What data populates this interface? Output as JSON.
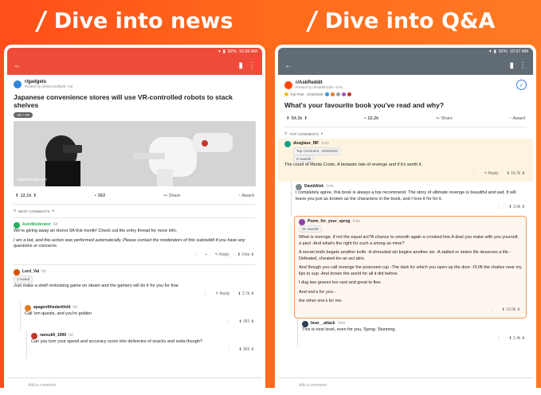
{
  "left_banner": "Dive into news",
  "right_banner": "Dive into Q&A",
  "left": {
    "status": {
      "battery": "92%",
      "time": "10:36 AM"
    },
    "post": {
      "subreddit": "r/gadgets",
      "posted": "Posted by u/MicroSofty88 • 6d",
      "title": "Japanese convenience stores will use VR-controlled robots to stack shelves",
      "flair": "VR / AR",
      "image_caption": "digitaltrends.com",
      "votes": "12.1k",
      "comments": "562",
      "share": "Share",
      "award": "Award"
    },
    "sort_label": "BEST COMMENTS",
    "comments": [
      {
        "author": "AutoModerator",
        "time": "6d",
        "text": "We're giving away an Honor 9A this month! Check out the entry thread for more info.",
        "text2": "I am a bot, and this action was performed automatically. Please contact the moderators of this subreddit if you have any questions or concerns.",
        "reply": "Reply",
        "vote": "Vote"
      },
      {
        "author": "Lord_Val",
        "time": "6d",
        "award": "1 Award",
        "text": "Just make a shelf restocking game on steam and the gamers will do it for you for free",
        "reply": "Reply",
        "votes": "2.7k"
      },
      {
        "author": "apageofthedarkfold",
        "time": "6d",
        "text": "Call 'em quests, and you're golden",
        "votes": "951"
      },
      {
        "author": "nareuk9_1999",
        "time": "6d",
        "text": "Can you turn your speed and accuracy score into deliveries of snacks and soda though?",
        "votes": "362"
      }
    ],
    "add_comment": "Add a comment"
  },
  "right": {
    "status": {
      "battery": "92%",
      "time": "10:37 AM"
    },
    "post": {
      "subreddit": "r/AskReddit",
      "posted": "Posted by u/reddit0135 • 1mo",
      "top_post": "Top Post - 5/26/2020",
      "title": "What's your favourite book you've read and why?",
      "votes": "54.3k",
      "comments": "22.2k",
      "share": "Share",
      "award": "Award"
    },
    "sort_label": "TOP COMMENTS",
    "comments": [
      {
        "author": "douglass_f8F",
        "time": "1mo",
        "top": "Top Comment - 5/26/2020",
        "awards": "5 Awards",
        "text": "The count of Monte Cristo. A fantastic tale of revenge and if it's worth it.",
        "reply": "Reply",
        "votes": "16.7k"
      },
      {
        "author": "DavidAlek",
        "time": "1mo",
        "text": "I completely agree, this book is always a top recommend. The story of ultimate revenge is beautiful and sad. It will leave you just as broken as the characters in the book, and I love it for for it.",
        "votes": "3.9k"
      },
      {
        "author": "Poem_for_your_sprog",
        "time": "1mo",
        "awards": "31 Awards",
        "p1": "What is revenge, if not the equal act?A chance to smooth again a crooked line.A deal you make with you yourself, a pact -And what's the right for such a wrong as mine?",
        "p2": "A secret knife begets another knife -A shrouded sin begins another sin -A stalled or stolen life deserves a life -Defeated, cheated kin an act akin.",
        "p3": "And though you call revenge the poisoned cup -The dark for which you open up the door -I'll lift the chalice near my lips to sup -And drown the world for all it did before.",
        "p4": "I dug two graves too vast and great to flee.",
        "p5": "And one's for you -",
        "p6": "the other one's for me.",
        "votes": "10.0k"
      },
      {
        "author": "bear__attack",
        "time": "1mo",
        "text": "This is next level, even for you, Sprog. Stunning.",
        "votes": "1.4k"
      }
    ],
    "add_comment": "Add a comment"
  },
  "colors": {
    "accent_left": "#ee4b3b",
    "accent_right": "#616b74",
    "background": "#ff5a1f"
  }
}
